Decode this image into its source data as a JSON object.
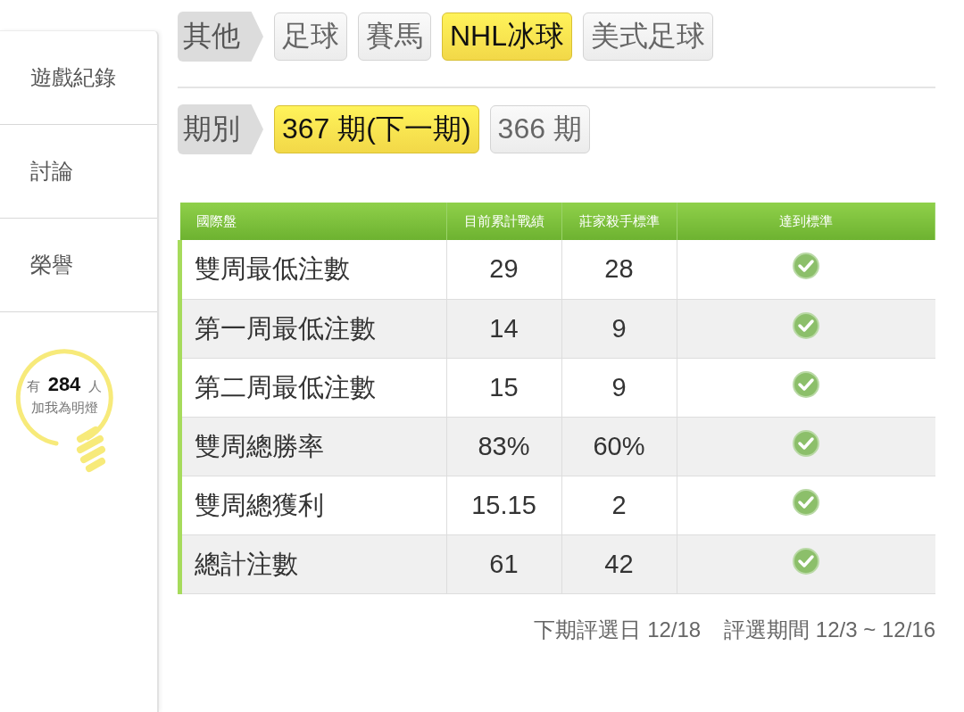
{
  "sidebar": {
    "items": [
      {
        "label": "遊戲紀錄"
      },
      {
        "label": "討論"
      },
      {
        "label": "榮譽"
      }
    ],
    "lamp": {
      "count_text": "有 **284** 人",
      "caption": "加我為明燈"
    }
  },
  "category": {
    "label": "其他",
    "tabs": [
      {
        "label": "足球",
        "selected": false
      },
      {
        "label": "賽馬",
        "selected": false
      },
      {
        "label": "NHL冰球",
        "selected": true
      },
      {
        "label": "美式足球",
        "selected": false
      }
    ]
  },
  "period": {
    "label": "期別",
    "tabs": [
      {
        "label": "367 期(下一期)",
        "selected": true
      },
      {
        "label": "366 期",
        "selected": false
      }
    ]
  },
  "table": {
    "columns": [
      "國際盤",
      "目前累計戰績",
      "莊家殺手標準",
      "達到標準"
    ],
    "rows": [
      {
        "name": "雙周最低注數",
        "current": "29",
        "standard": "28",
        "met": true
      },
      {
        "name": "第一周最低注數",
        "current": "14",
        "standard": "9",
        "met": true
      },
      {
        "name": "第二周最低注數",
        "current": "15",
        "standard": "9",
        "met": true
      },
      {
        "name": "雙周總勝率",
        "current": "83%",
        "standard": "60%",
        "met": true
      },
      {
        "name": "雙周總獲利",
        "current": "15.15",
        "standard": "2",
        "met": true
      },
      {
        "name": "總計注數",
        "current": "61",
        "standard": "42",
        "met": true
      }
    ]
  },
  "footer": {
    "next_date": "下期評選日 12/18",
    "period_range": "評選期間 12/3 ~ 12/16"
  }
}
